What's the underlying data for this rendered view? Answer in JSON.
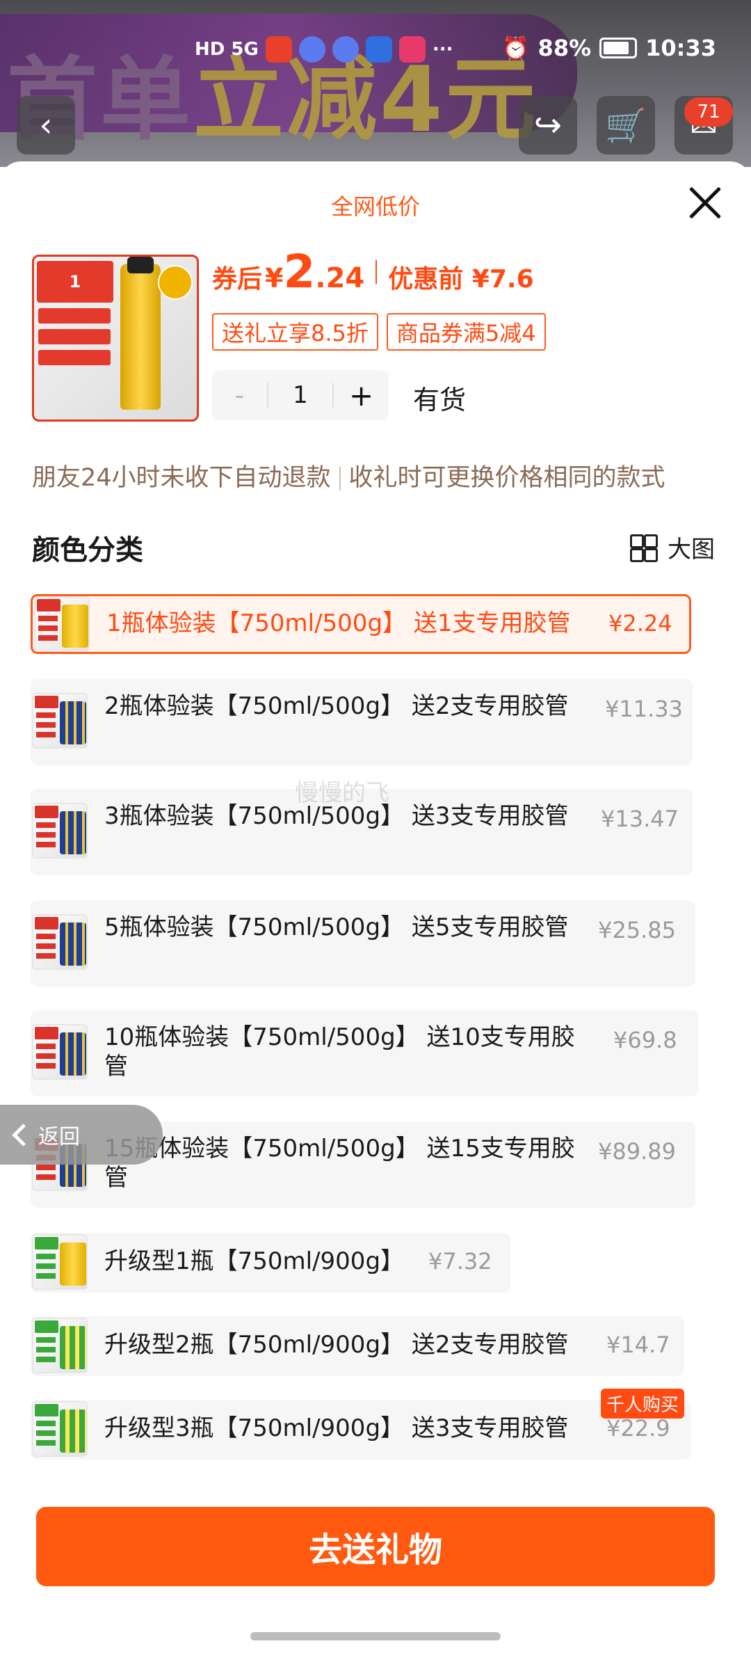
{
  "status_bar": {
    "signal_text": "HD 5G",
    "battery_pct": "88%",
    "time": "10:33",
    "more": "···"
  },
  "background": {
    "banner_text_a": "首单",
    "banner_text_b": "立减4元",
    "cart_badge": "71"
  },
  "sheet": {
    "title": "全网低价",
    "price": {
      "after_label": "券后",
      "yen": "¥",
      "int": "2",
      "dec": ".24",
      "before_label": "优惠前 ¥7.6"
    },
    "tags": [
      "送礼立享8.5折",
      "商品券满5减4"
    ],
    "quantity": "1",
    "minus": "-",
    "plus": "+",
    "stock": "有货",
    "notice_a": "朋友24小时未收下自动退款",
    "notice_b": "收礼时可更换价格相同的款式",
    "section_title": "颜色分类",
    "big_view": "大图",
    "options": [
      {
        "name": "1瓶体验装【750ml/500g】 送1支专用胶管",
        "price": "¥2.24"
      },
      {
        "name": "2瓶体验装【750ml/500g】 送2支专用胶管",
        "price": "¥11.33"
      },
      {
        "name": "3瓶体验装【750ml/500g】 送3支专用胶管",
        "price": "¥13.47"
      },
      {
        "name": "5瓶体验装【750ml/500g】 送5支专用胶管",
        "price": "¥25.85"
      },
      {
        "name": "10瓶体验装【750ml/500g】 送10支专用胶管",
        "price": "¥69.8"
      },
      {
        "name": "15瓶体验装【750ml/500g】 送15支专用胶管",
        "price": "¥89.89"
      },
      {
        "name": "升级型1瓶【750ml/900g】",
        "price": "¥7.32"
      },
      {
        "name": "升级型2瓶【750ml/900g】 送2支专用胶管",
        "price": "¥14.7"
      },
      {
        "name": "升级型3瓶【750ml/900g】 送3支专用胶管",
        "price": "¥22.9"
      }
    ],
    "hot_badge": "千人购买",
    "back_label": "返回",
    "watermark": "慢慢的飞",
    "cta": "去送礼物"
  },
  "colors": {
    "accent": "#ff5a10",
    "price": "#ff4b12"
  }
}
